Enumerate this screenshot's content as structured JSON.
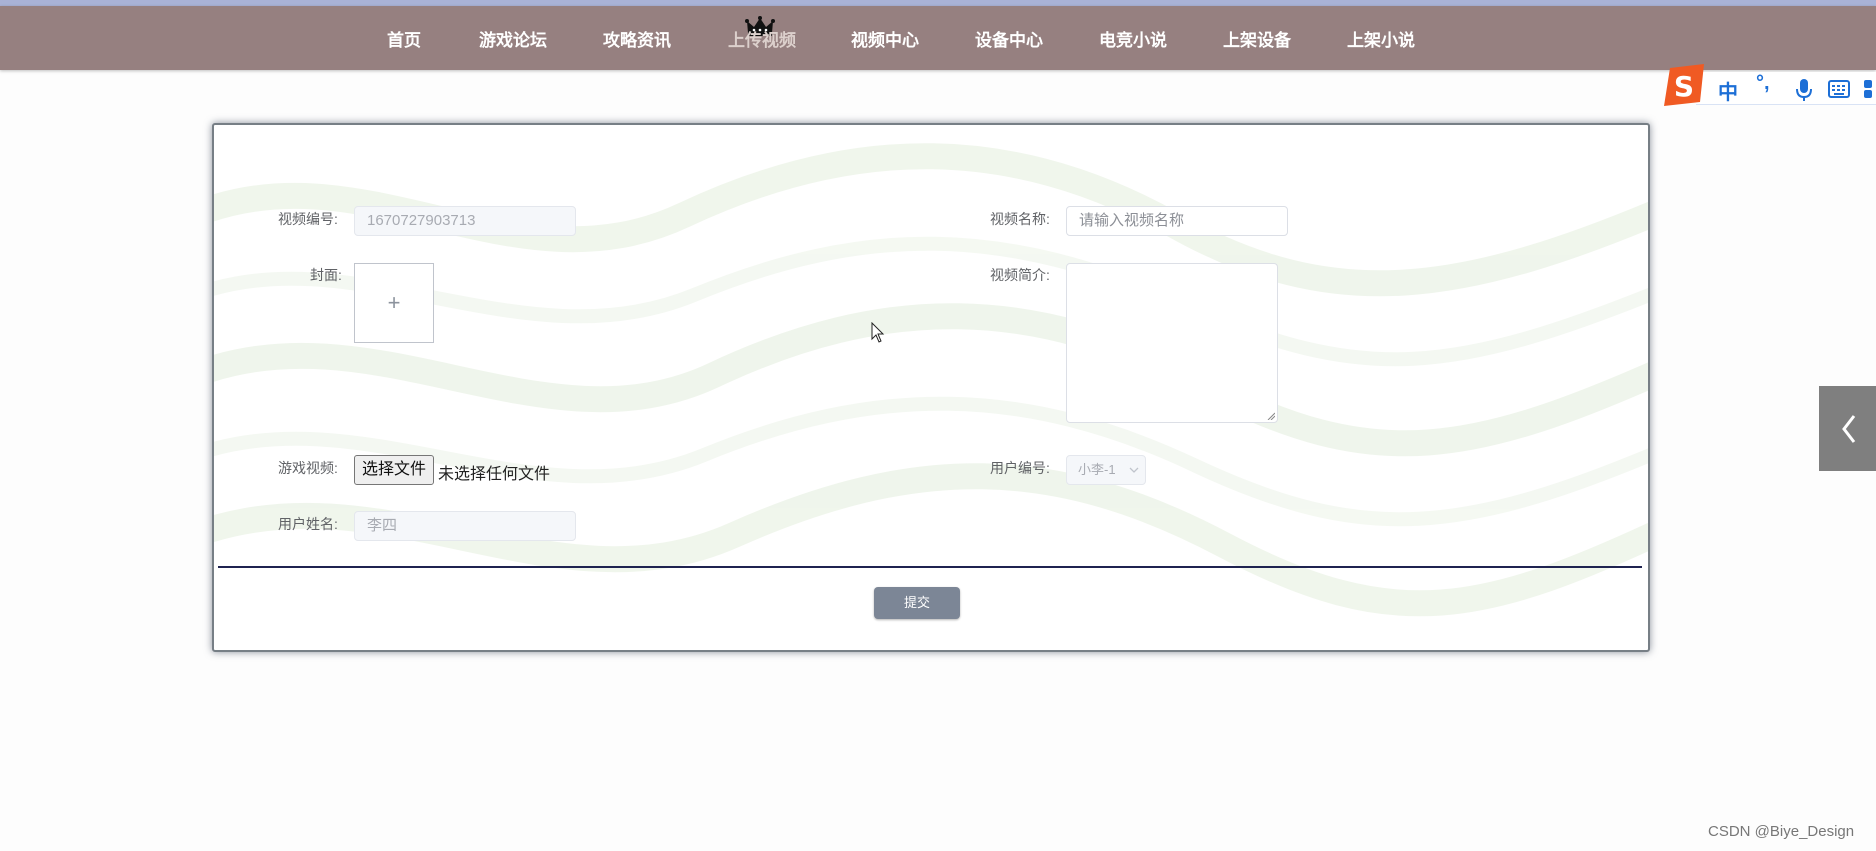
{
  "nav": {
    "items": [
      {
        "label": "首页"
      },
      {
        "label": "游戏论坛"
      },
      {
        "label": "攻略资讯"
      },
      {
        "label": "上传视频"
      },
      {
        "label": "视频中心"
      },
      {
        "label": "设备中心"
      },
      {
        "label": "电竞小说"
      },
      {
        "label": "上架设备"
      },
      {
        "label": "上架小说"
      }
    ],
    "active_item": "上传视频",
    "active_icon": "crown-icon"
  },
  "ime": {
    "logo_icon": "sogou-s-icon",
    "lang_label": "中",
    "punct_label": "°,",
    "mic_icon": "microphone-icon",
    "keyboard_icon": "keyboard-icon"
  },
  "form": {
    "video_id": {
      "label": "视频编号:",
      "value": "1670727903713"
    },
    "video_name": {
      "label": "视频名称:",
      "placeholder": "请输入视频名称"
    },
    "cover": {
      "label": "封面:",
      "upload_symbol": "+"
    },
    "video_intro": {
      "label": "视频简介:"
    },
    "game_video": {
      "label": "游戏视频:",
      "button_label": "选择文件",
      "status": "未选择任何文件"
    },
    "user_id": {
      "label": "用户编号:",
      "value": "小李-1"
    },
    "user_name": {
      "label": "用户姓名:",
      "value": "李四"
    },
    "submit_label": "提交"
  },
  "side_tab": {
    "icon": "chevron-left-icon"
  },
  "watermark": "CSDN @Biye_Design",
  "colors": {
    "navbar": "#968080",
    "top_strip": "#a9b2d6",
    "submit": "#7c8696",
    "divider": "#1f2350",
    "ime_blue": "#1d6fd6",
    "sogou_orange": "#f05a23"
  }
}
